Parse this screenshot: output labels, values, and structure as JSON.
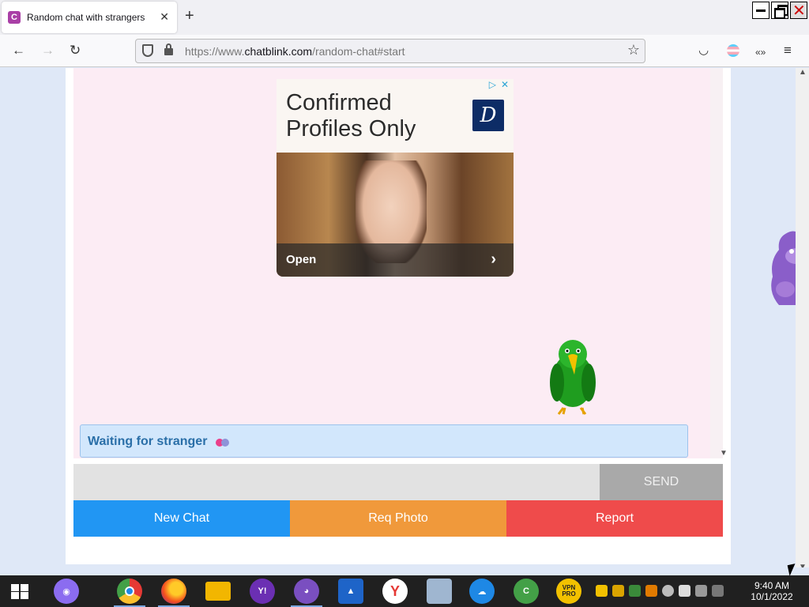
{
  "browser": {
    "tab_title": "Random chat with strangers",
    "tab_favicon": "C",
    "url_prefix": "https://www.",
    "url_host": "chatblink.com",
    "url_path": "/random-chat#start"
  },
  "ad": {
    "headline": "Confirmed Profiles Only",
    "cta": "Open",
    "logo_letter": "D"
  },
  "chat": {
    "status": "Waiting for stranger",
    "message_placeholder": "",
    "send_label": "SEND"
  },
  "actions": [
    {
      "label": "New Chat",
      "color": "#2196f3"
    },
    {
      "label": "Req Photo",
      "color": "#f0993b"
    },
    {
      "label": "Report",
      "color": "#ef4b4b"
    }
  ],
  "taskbar": {
    "apps": [
      "windows-start",
      "cortana",
      "chrome",
      "firefox",
      "file-explorer",
      "yahoo-messenger",
      "bonzi-buddy",
      "arc",
      "yandex",
      "disk-tool",
      "cloud-app",
      "ccleaner",
      "vpn-pro"
    ],
    "vpn_label": "VPN PRO",
    "time": "9:40 AM",
    "date": "10/1/2022"
  },
  "colors": {
    "chat_background": "#fcecf4",
    "status_text": "#2a6fa8",
    "send_disabled": "#a9a9a9"
  }
}
